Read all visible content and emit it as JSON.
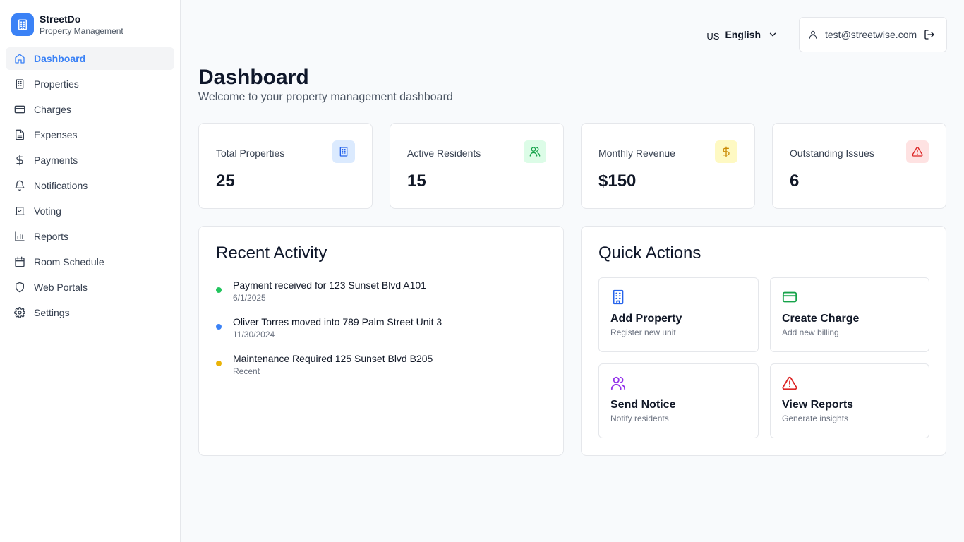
{
  "brand": {
    "name": "StreetDo",
    "subtitle": "Property Management",
    "color": "#3b82f6"
  },
  "sidebar": {
    "items": [
      {
        "label": "Dashboard",
        "icon": "home-icon",
        "active": true
      },
      {
        "label": "Properties",
        "icon": "building-icon"
      },
      {
        "label": "Charges",
        "icon": "credit-card-icon"
      },
      {
        "label": "Expenses",
        "icon": "file-text-icon"
      },
      {
        "label": "Payments",
        "icon": "dollar-icon"
      },
      {
        "label": "Notifications",
        "icon": "bell-icon"
      },
      {
        "label": "Voting",
        "icon": "vote-icon"
      },
      {
        "label": "Reports",
        "icon": "bar-chart-icon"
      },
      {
        "label": "Room Schedule",
        "icon": "calendar-icon"
      },
      {
        "label": "Web Portals",
        "icon": "shield-icon"
      },
      {
        "label": "Settings",
        "icon": "gear-icon"
      }
    ]
  },
  "header": {
    "language_code": "US",
    "language": "English",
    "user_email": "test@streetwise.com"
  },
  "page": {
    "title": "Dashboard",
    "subtitle": "Welcome to your property management dashboard"
  },
  "stats": [
    {
      "label": "Total Properties",
      "value": "25",
      "icon": "building-icon",
      "bg": "#dbeafe",
      "fg": "#2563eb"
    },
    {
      "label": "Active Residents",
      "value": "15",
      "icon": "users-icon",
      "bg": "#dcfce7",
      "fg": "#16a34a"
    },
    {
      "label": "Monthly Revenue",
      "value": "$150",
      "icon": "dollar-icon",
      "bg": "#fef9c3",
      "fg": "#ca8a04"
    },
    {
      "label": "Outstanding Issues",
      "value": "6",
      "icon": "alert-triangle-icon",
      "bg": "#fee2e2",
      "fg": "#dc2626"
    }
  ],
  "recent_activity": {
    "title": "Recent Activity",
    "items": [
      {
        "text": "Payment received for 123 Sunset Blvd A101",
        "date": "6/1/2025",
        "color": "#22c55e"
      },
      {
        "text": "Oliver Torres moved into 789 Palm Street Unit 3",
        "date": "11/30/2024",
        "color": "#3b82f6"
      },
      {
        "text": "Maintenance Required 125 Sunset Blvd B205",
        "date": "Recent",
        "color": "#eab308"
      }
    ]
  },
  "quick_actions": {
    "title": "Quick Actions",
    "items": [
      {
        "title": "Add Property",
        "subtitle": "Register new unit",
        "icon": "building-icon",
        "color": "#2563eb"
      },
      {
        "title": "Create Charge",
        "subtitle": "Add new billing",
        "icon": "credit-card-icon",
        "color": "#16a34a"
      },
      {
        "title": "Send Notice",
        "subtitle": "Notify residents",
        "icon": "users-icon",
        "color": "#9333ea"
      },
      {
        "title": "View Reports",
        "subtitle": "Generate insights",
        "icon": "alert-triangle-icon",
        "color": "#dc2626"
      }
    ]
  }
}
